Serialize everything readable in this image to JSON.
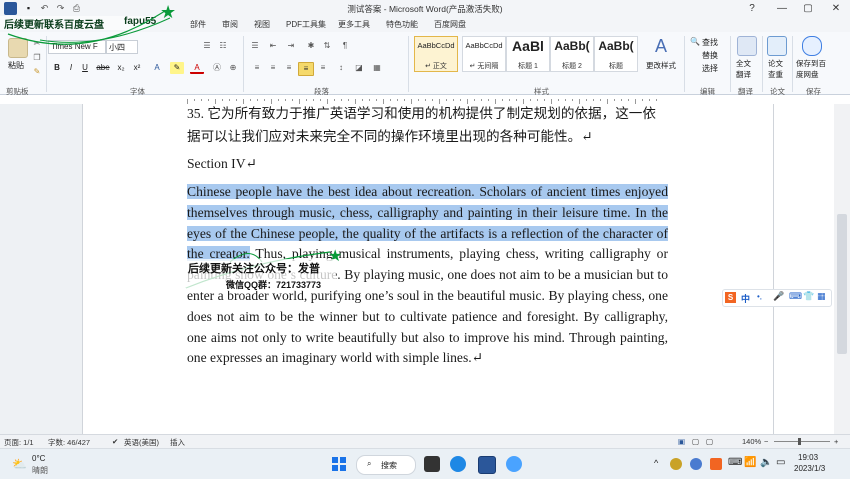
{
  "window": {
    "title": "测试答案 - Microsoft Word(产品激活失败)",
    "controls": [
      "?",
      "—",
      "▢",
      "✕"
    ]
  },
  "ribbon": {
    "tabs": [
      "部件",
      "审阅",
      "视图",
      "PDF工具集",
      "更多工具",
      "特色功能",
      "百度网盘"
    ],
    "clipboard": {
      "paste": "粘贴",
      "group": "剪贴板"
    },
    "font": {
      "name": "Times New F",
      "size": "小四",
      "group": "字体",
      "buttons": [
        "B",
        "I",
        "U",
        "abe",
        "x₂",
        "x²",
        "A",
        "A"
      ]
    },
    "paragraph": {
      "group": "段落"
    },
    "styles": {
      "group": "样式",
      "items": [
        {
          "preview": "AaBbCcDd",
          "label": "↵ 正文"
        },
        {
          "preview": "AaBbCcDd",
          "label": "↵ 无间隔"
        },
        {
          "preview": "AaBl",
          "label": "标题 1"
        },
        {
          "preview": "AaBb(",
          "label": "标题 2"
        },
        {
          "preview": "AaBb(",
          "label": "标题"
        }
      ],
      "change": "更改样式"
    },
    "editing": {
      "group": "编辑",
      "find": "查找",
      "replace": "替换",
      "select": "选择"
    },
    "translate": {
      "label": "全文\n翻译",
      "group": "翻译"
    },
    "paper": {
      "label": "论文\n查重",
      "group": "论文"
    },
    "save": {
      "label": "保存到百\n度网盘",
      "group": "保存"
    }
  },
  "document": {
    "line1": "35. 它为所有致力于推广英语学习和使用的机构提供了制定规划的依据，这一依",
    "line2": "据可以让我们应对未来完全不同的操作环境里出现的各种可能性。↵",
    "heading": "Section IV↵",
    "body_highlighted": "Chinese people have the best idea about recreation. Scholars of ancient times enjoyed themselves through music, chess, calligraphy and painting in their leisure time. In the eyes of the Chinese people, the quality of the artifacts is a reflection of the character of the creator.",
    "body_rest": " Thus, playing musical instruments, playing chess, writing calligraphy or painting show one’s culture. By playing music, one does not aim to be a musician but to enter a broader world, purifying one’s soul in the beautiful music. By playing chess, one does not aim to be the winner but to cultivate patience and foresight. By calligraphy, one aims not only to write beautifully but also to improve his mind. Through painting, one expresses an imaginary world with simple lines.↵"
  },
  "statusbar": {
    "page": "页面: 1/1",
    "words": "字数: 46/427",
    "lang": "英语(美国)",
    "mode": "插入",
    "zoom": "140%"
  },
  "taskbar": {
    "weather_temp": "0°C",
    "weather_desc": "晴朗",
    "search": "搜索",
    "time": "19:03",
    "date": "2023/1/3"
  },
  "ime": {
    "label": "中"
  },
  "overlay": {
    "top_banner": "后续更新联系百度云盘",
    "top_id": "fapu55",
    "mid_line1": "后续更新关注公众号：发普",
    "mid_line2": "微信QQ群：721733773"
  },
  "colors": {
    "accent": "#2b579a",
    "highlight": "#a8c9ef",
    "watermark": "#0a9a3a"
  }
}
